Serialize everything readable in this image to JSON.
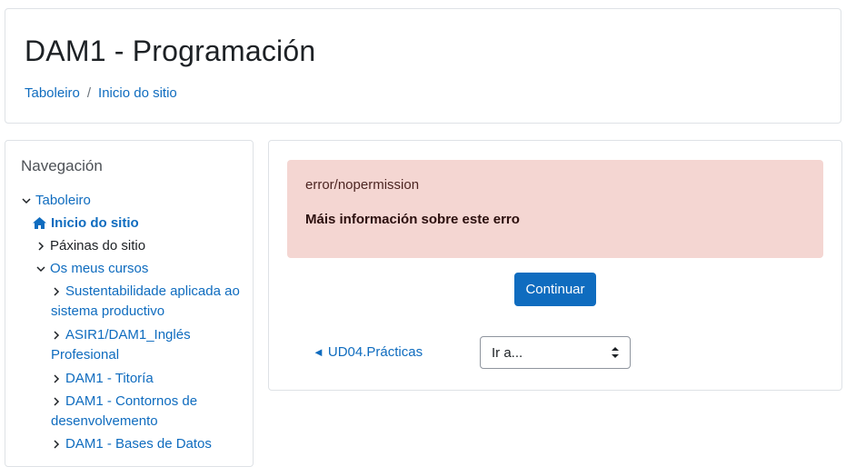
{
  "header": {
    "title": "DAM1 - Programación",
    "breadcrumb": [
      "Taboleiro",
      "Inicio do sitio"
    ],
    "breadcrumb_separator": "/"
  },
  "navigation": {
    "title": "Navegación",
    "items": [
      {
        "label": "Taboleiro",
        "expanded": true,
        "icon": "chevron-down-icon"
      },
      {
        "label": "Inicio do sitio",
        "icon": "home-icon",
        "active": true
      },
      {
        "label": "Páxinas do sitio",
        "icon": "chevron-right-icon"
      },
      {
        "label": "Os meus cursos",
        "icon": "chevron-down-icon",
        "expanded": true
      },
      {
        "label_line1": "Sustentabilidade aplicada ao",
        "label_line2": "sistema productivo",
        "icon": "chevron-right-icon"
      },
      {
        "label_line1": "ASIR1/DAM1_Inglés",
        "label_line2": "Profesional",
        "icon": "chevron-right-icon"
      },
      {
        "label": "DAM1 - Titoría",
        "icon": "chevron-right-icon"
      },
      {
        "label_line1": "DAM1 - Contornos de",
        "label_line2": "desenvolvemento",
        "icon": "chevron-right-icon"
      },
      {
        "label": "DAM1 - Bases de Datos",
        "icon": "chevron-right-icon"
      }
    ]
  },
  "error": {
    "code": "error/nopermission",
    "more_info": "Máis información sobre este erro",
    "bg_color": "#f4d6d2"
  },
  "actions": {
    "continue_label": "Continuar",
    "prev_activity": "UD04.Prácticas",
    "prev_arrow": "◄",
    "jump_to": "Ir a..."
  },
  "colors": {
    "accent": "#0f6cbf",
    "text": "#1d2125"
  }
}
